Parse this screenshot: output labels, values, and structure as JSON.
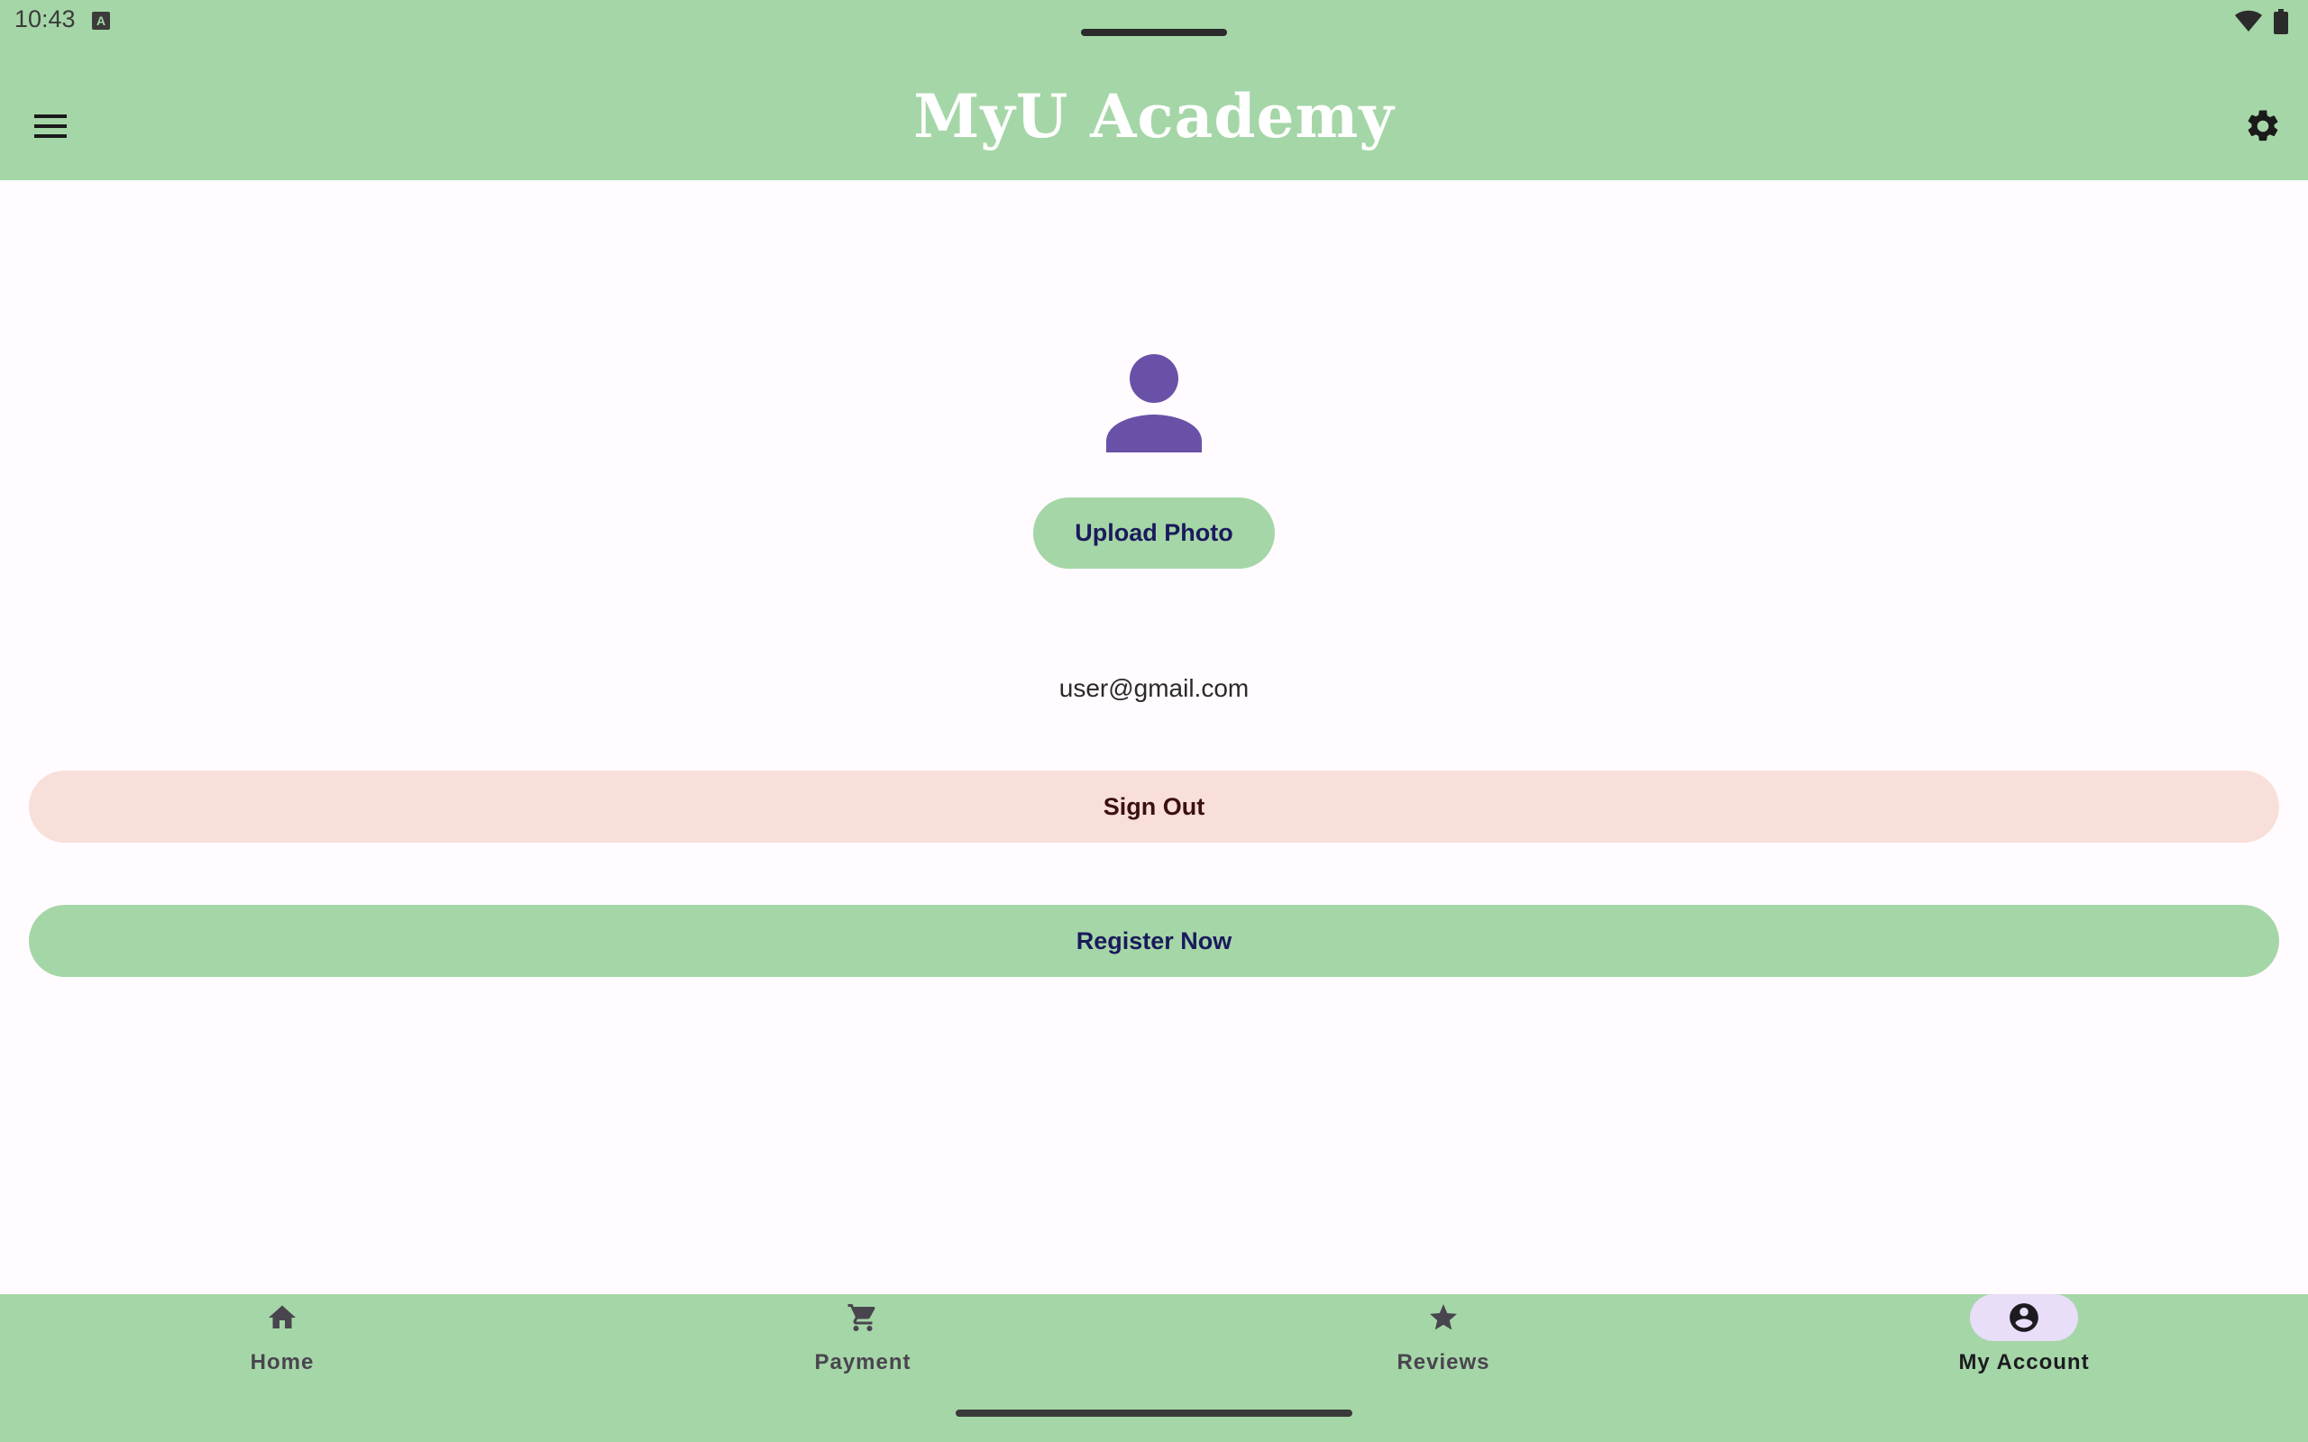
{
  "status_bar": {
    "time": "10:43",
    "notification_glyph": "A",
    "icons": [
      "wifi-icon",
      "battery-icon"
    ]
  },
  "app_bar": {
    "title": "MyU Academy",
    "left_icon": "menu-icon",
    "right_icon": "gear-icon"
  },
  "profile": {
    "avatar_icon": "person-icon",
    "upload_label": "Upload Photo",
    "email": "user@gmail.com"
  },
  "actions": {
    "sign_out_label": "Sign Out",
    "register_label": "Register Now"
  },
  "bottom_nav": {
    "selected": "My Account",
    "items": [
      {
        "label": "Home",
        "icon": "home-icon"
      },
      {
        "label": "Payment",
        "icon": "cart-icon"
      },
      {
        "label": "Reviews",
        "icon": "star-icon"
      },
      {
        "label": "My Account",
        "icon": "account-circle-icon"
      }
    ]
  },
  "colors": {
    "primary_green": "#a5d6a7",
    "avatar_purple": "#6a51a8",
    "sign_out_bg": "#f9dfd9",
    "nav_active_pill": "#e8def8",
    "title_text": "#ffffff"
  }
}
